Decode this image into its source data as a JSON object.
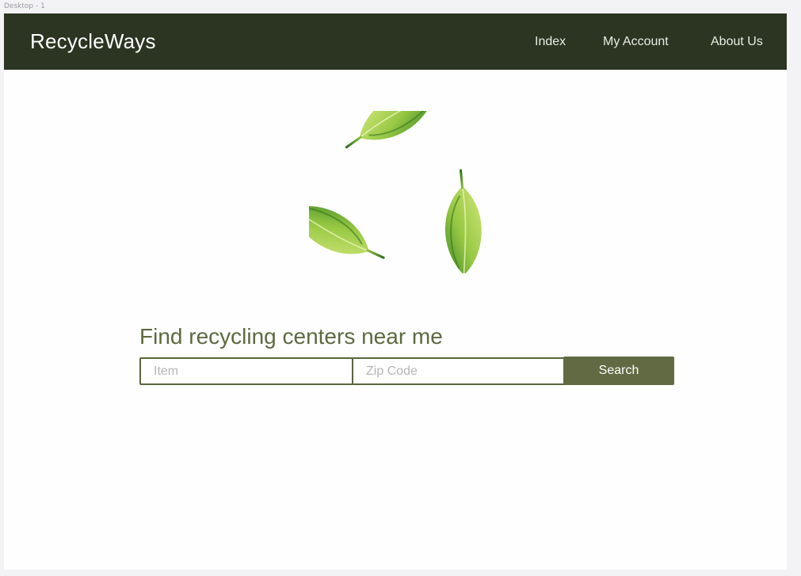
{
  "frame": {
    "label": "Desktop - 1"
  },
  "nav": {
    "brand": "RecycleWays",
    "links": [
      "Index",
      "My Account",
      "About Us"
    ]
  },
  "hero": {
    "logo_icon": "recycle-leaves-icon",
    "headline": "Find recycling centers near me"
  },
  "search": {
    "item_placeholder": "Item",
    "zip_placeholder": "Zip Code",
    "button_label": "Search"
  },
  "colors": {
    "nav_background": "#2b3522",
    "accent": "#616a43",
    "headline": "#5d6a40",
    "leaf_light": "#b5d65a",
    "leaf_dark": "#3f8a26"
  }
}
